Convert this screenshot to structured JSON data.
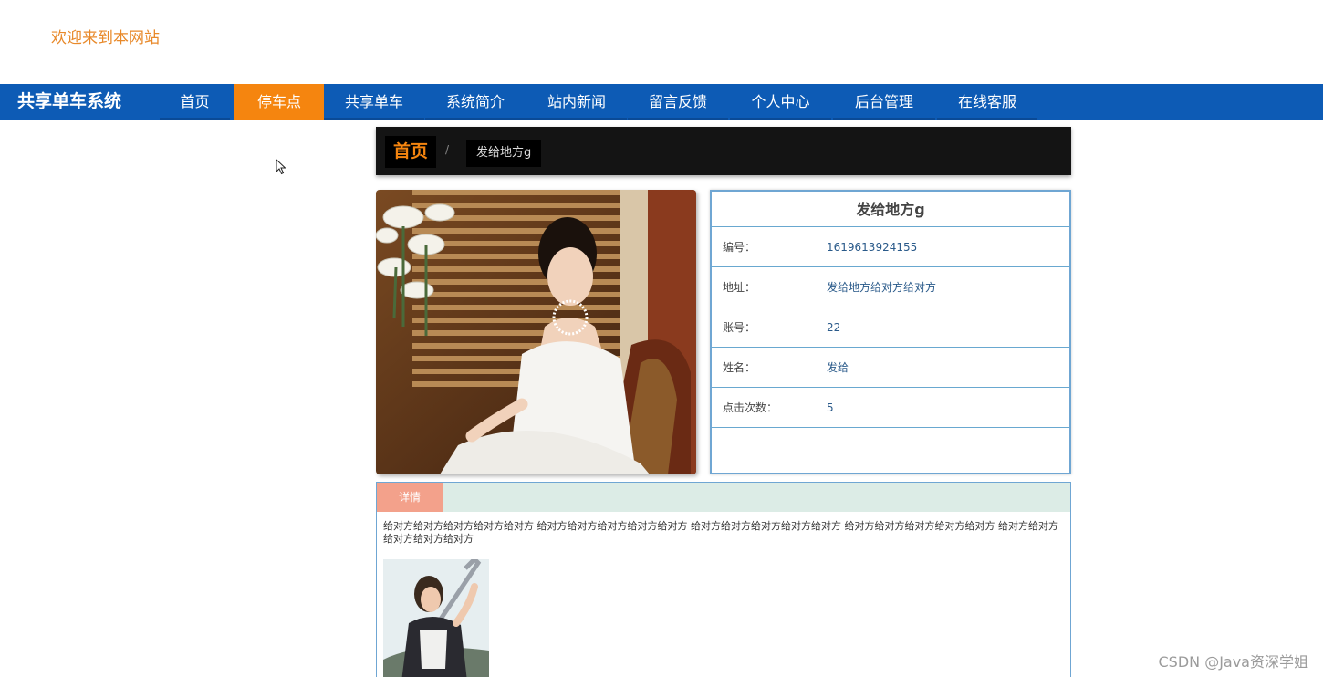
{
  "header": {
    "welcome_text": "欢迎来到本网站"
  },
  "nav": {
    "brand": "共享单车系统",
    "items": [
      {
        "label": "首页"
      },
      {
        "label": "停车点",
        "active": true
      },
      {
        "label": "共享单车"
      },
      {
        "label": "系统简介"
      },
      {
        "label": "站内新闻"
      },
      {
        "label": "留言反馈"
      },
      {
        "label": "个人中心"
      },
      {
        "label": "后台管理"
      },
      {
        "label": "在线客服"
      }
    ],
    "accent_color": "#f5850f",
    "bar_color": "#0d5bb5"
  },
  "breadcrumb": {
    "home": "首页",
    "separator": "/",
    "current": "发给地方g"
  },
  "info": {
    "title": "发给地方g",
    "rows": [
      {
        "label": "编号：",
        "value": "1619613924155"
      },
      {
        "label": "地址：",
        "value": "发给地方给对方给对方"
      },
      {
        "label": "账号：",
        "value": "22"
      },
      {
        "label": "姓名：",
        "value": "发给"
      },
      {
        "label": "点击次数：",
        "value": "5"
      }
    ]
  },
  "detail": {
    "tab_label": "详情",
    "text": "给对方给对方给对方给对方给对方 给对方给对方给对方给对方给对方 给对方给对方给对方给对方给对方 给对方给对方给对方给对方给对方 给对方给对方给对方给对方给对方"
  },
  "icons": {
    "cursor": "mouse-pointer-icon"
  },
  "watermark": "CSDN @Java资深学姐"
}
